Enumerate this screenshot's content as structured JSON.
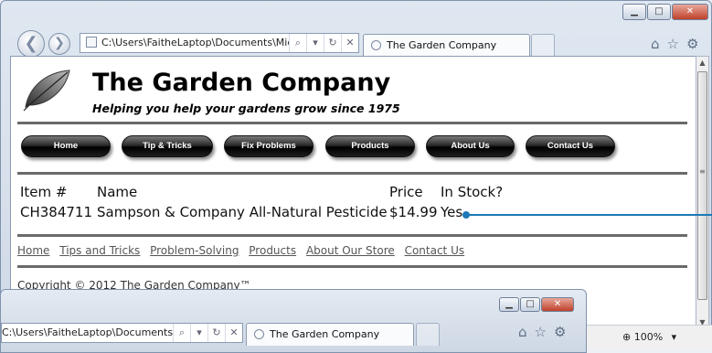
{
  "browser_front": {
    "address": "C:\\Users\\FaitheLaptop\\Documents\\Micr",
    "tab_title": "The Garden Company",
    "addr_search": "⌕",
    "addr_dropdown": "▾",
    "addr_refresh": "↻",
    "addr_stop": "✕",
    "back_glyph": "❮",
    "forward_glyph": "❯",
    "minimize": "▁",
    "maximize": "□",
    "close": "✕",
    "home_icon": "⌂",
    "favorites_icon": "☆",
    "tools_icon": "⚙"
  },
  "page": {
    "site_title": "The Garden Company",
    "tagline": "Helping you help your gardens grow since 1975",
    "nav": [
      "Home",
      "Tip & Tricks",
      "Fix Problems",
      "Products",
      "About Us",
      "Contact Us"
    ],
    "table": {
      "headers": [
        "Item #",
        "Name",
        "Price",
        "In Stock?"
      ],
      "row": [
        "CH384711",
        "Sampson & Company All-Natural Pesticide",
        "$14.99",
        "Yes"
      ]
    },
    "footer_links": [
      "Home",
      "Tips and Tricks",
      "Problem-Solving",
      "Products",
      "About Our Store",
      "Contact Us"
    ],
    "copyright": "Copyright © 2012 The Garden Company™"
  },
  "browser_back": {
    "address": "C:\\Users\\FaitheLaptop\\Documents\\M",
    "tab_title": "The Garden Company",
    "addr_search": "⌕",
    "addr_dropdown": "▾",
    "addr_refresh": "↻",
    "addr_stop": "✕",
    "minimize": "▁",
    "maximize": "□",
    "close": "✕",
    "home_icon": "⌂",
    "favorites_icon": "☆",
    "tools_icon": "⚙"
  },
  "status": {
    "zoom": "100%",
    "zoom_dropdown": "▾"
  },
  "colors": {
    "callout_line": "#1c78b7",
    "nav_button": "#000000"
  }
}
